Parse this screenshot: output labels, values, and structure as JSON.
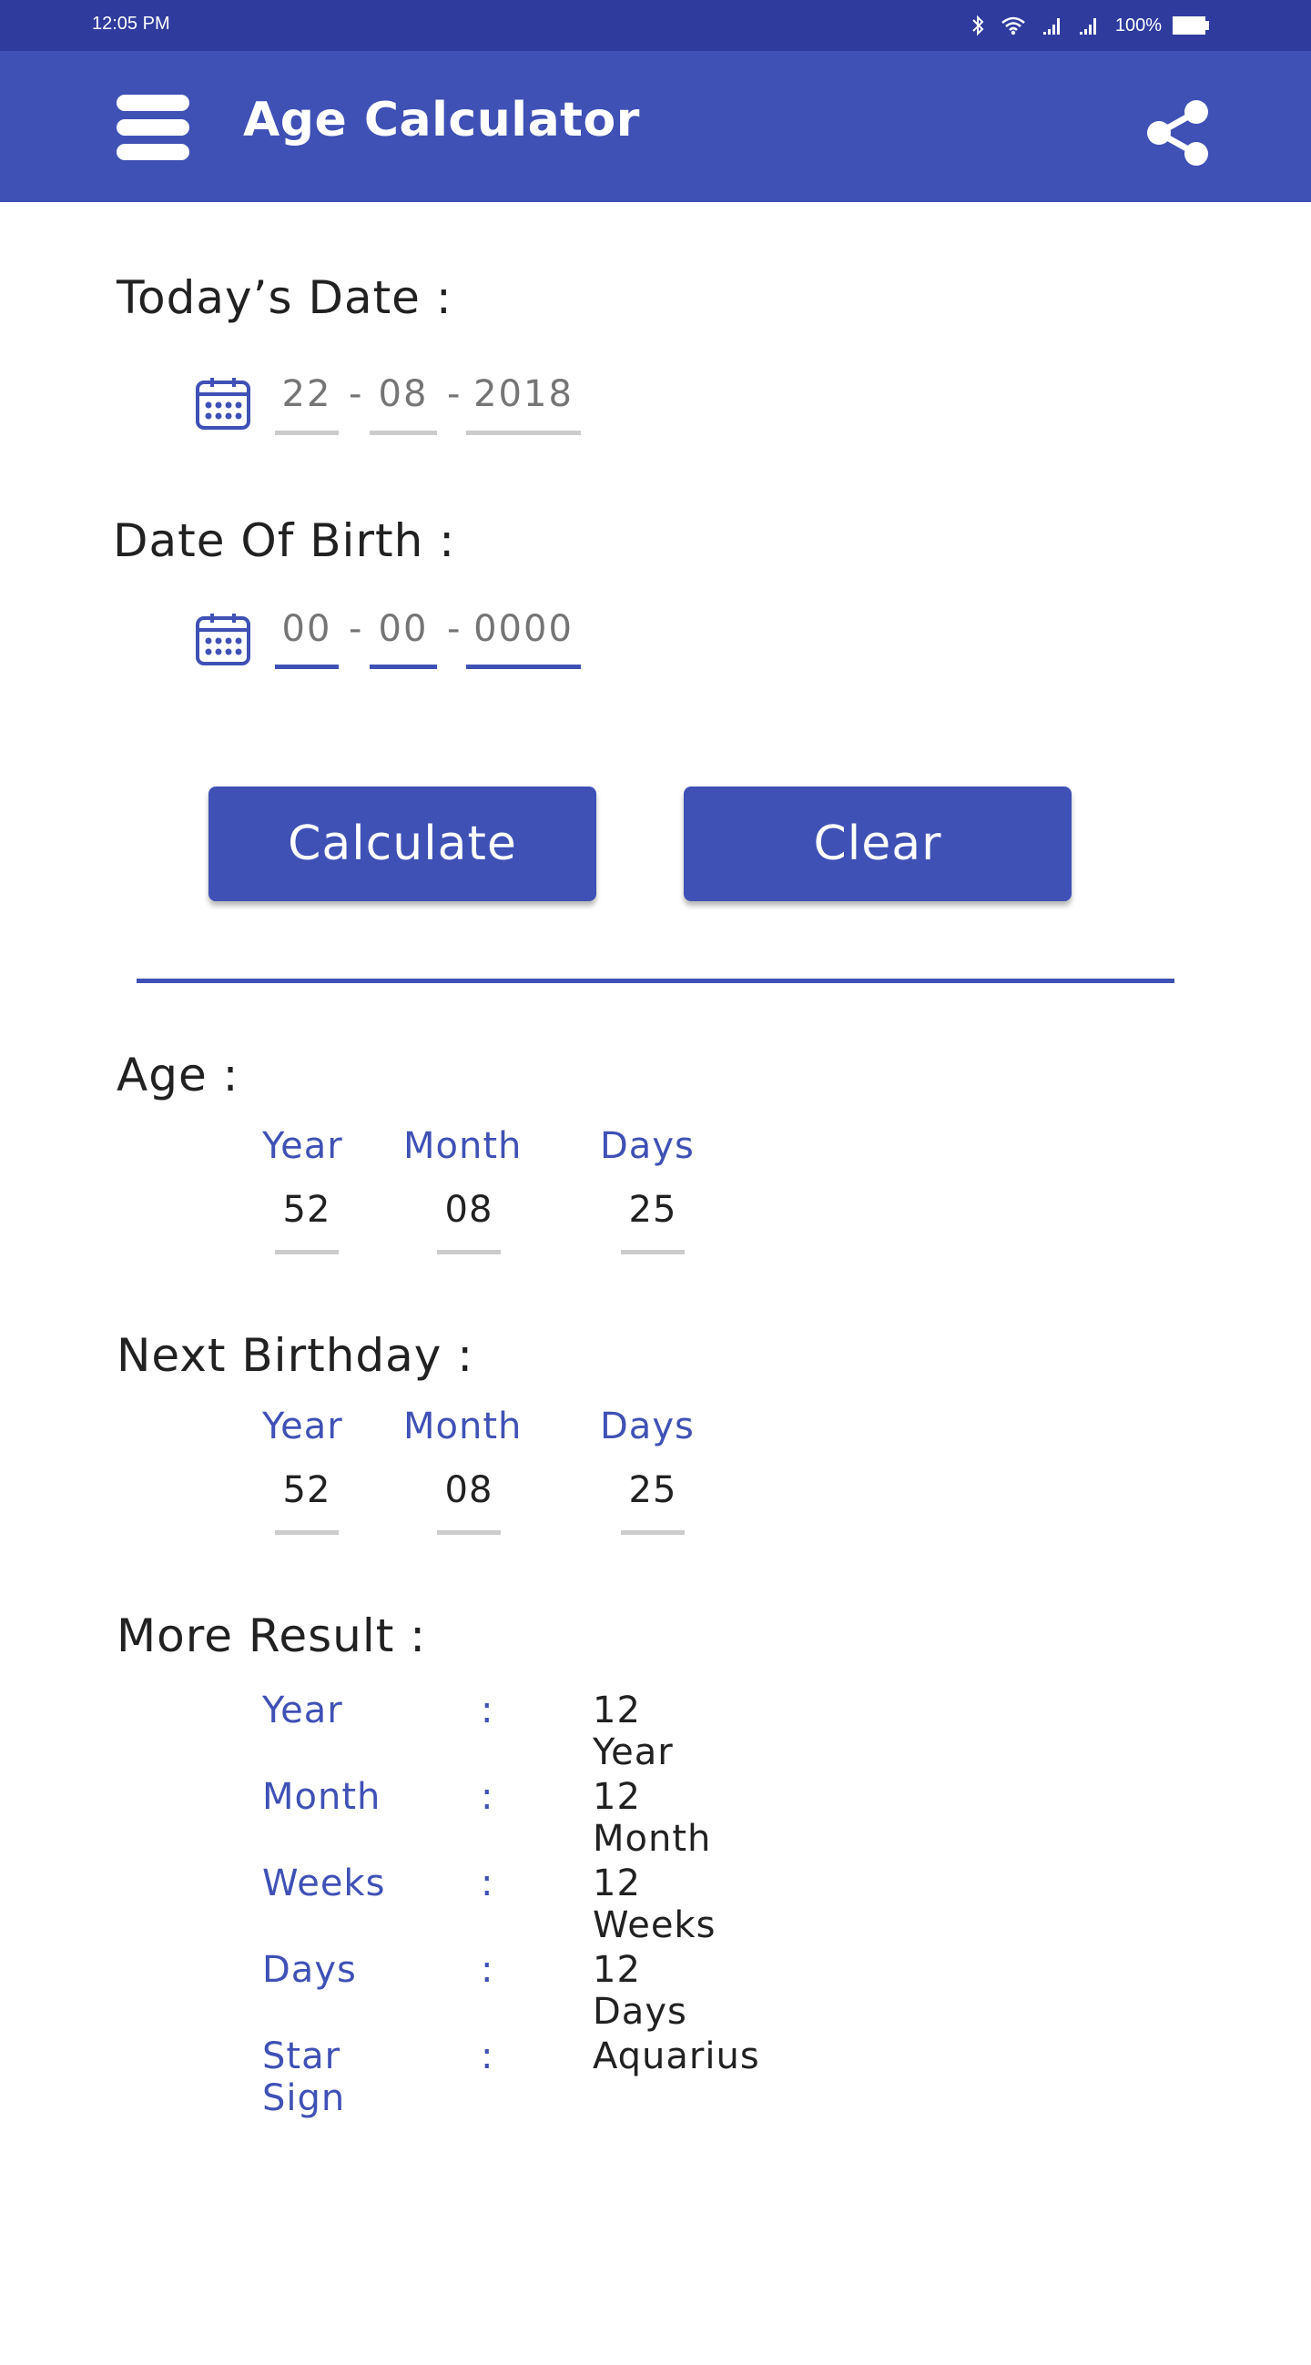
{
  "status_bar": {
    "time": "12:05 PM",
    "battery_percent": "100%",
    "icons": [
      "bluetooth-icon",
      "wifi-icon",
      "signal-icon",
      "signal-icon",
      "battery-icon"
    ]
  },
  "app_bar": {
    "title": "Age Calculator",
    "menu_icon": "hamburger-menu-icon",
    "share_icon": "share-icon"
  },
  "todays_date": {
    "label": "Today’s Date :",
    "icon": "calendar-icon",
    "day": "22",
    "month": "08",
    "year": "2018",
    "separator": "-"
  },
  "date_of_birth": {
    "label": "Date Of Birth :",
    "icon": "calendar-icon",
    "day_placeholder": "00",
    "month_placeholder": "00",
    "year_placeholder": "0000",
    "separator": "-"
  },
  "buttons": {
    "calculate": "Calculate",
    "clear": "Clear"
  },
  "age": {
    "label": "Age :",
    "columns": [
      {
        "label": "Year",
        "value": "52"
      },
      {
        "label": "Month",
        "value": "08"
      },
      {
        "label": "Days",
        "value": "25"
      }
    ]
  },
  "next_birthday": {
    "label": "Next Birthday :",
    "columns": [
      {
        "label": "Year",
        "value": "52"
      },
      {
        "label": "Month",
        "value": "08"
      },
      {
        "label": "Days",
        "value": "25"
      }
    ]
  },
  "more_result": {
    "label": "More Result :",
    "separator": ":",
    "rows": [
      {
        "label": "Year",
        "value": "12 Year"
      },
      {
        "label": "Month",
        "value": "12 Month"
      },
      {
        "label": "Weeks",
        "value": "12 Weeks"
      },
      {
        "label": "Days",
        "value": "12 Days"
      },
      {
        "label": "Star Sign",
        "value": "Aquarius"
      }
    ]
  },
  "colors": {
    "primary": "#3F51B5",
    "primary_dark": "#2F3C9E",
    "text": "#212121",
    "hint": "#757575",
    "underline_inactive": "#CCCCCC"
  }
}
